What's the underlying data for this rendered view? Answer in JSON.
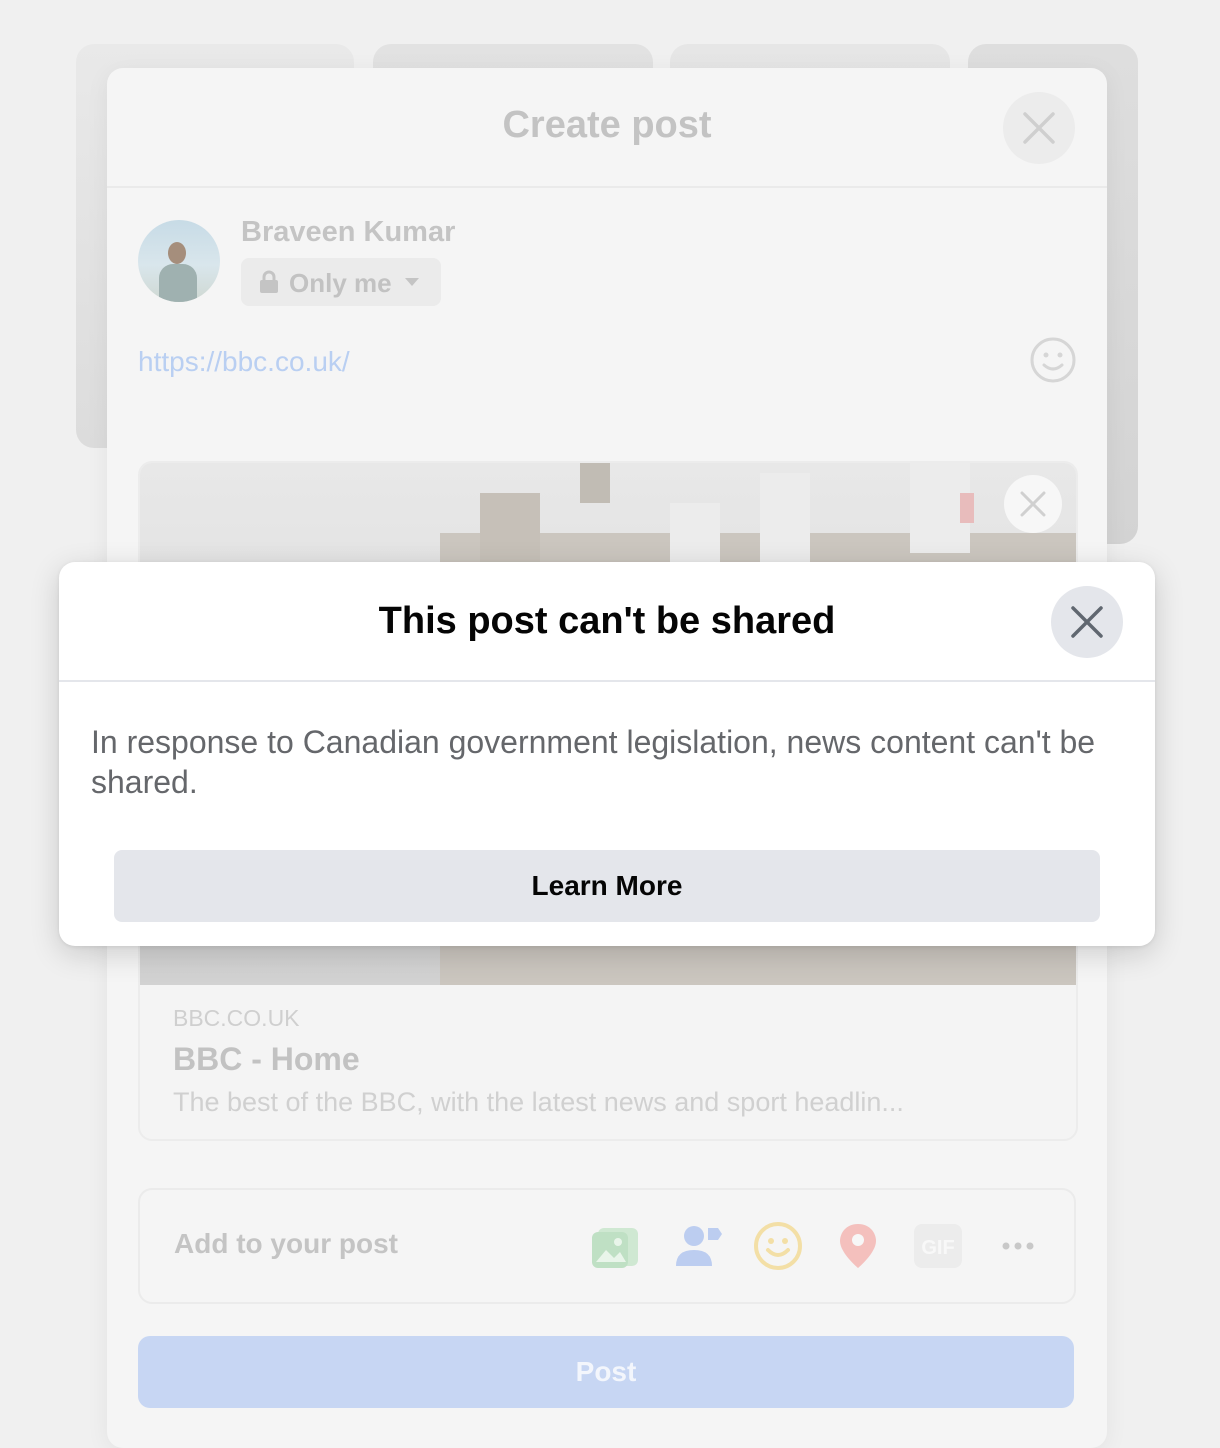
{
  "create_post": {
    "title": "Create post",
    "user_name": "Braveen Kumar",
    "privacy_label": "Only me",
    "post_text": "https://bbc.co.uk/",
    "link_preview": {
      "domain": "BBC.CO.UK",
      "title": "BBC - Home",
      "description": "The best of the BBC, with the latest news and sport headlin..."
    },
    "add_to_post_label": "Add to your post",
    "add_icons": [
      "photo-video-icon",
      "tag-people-icon",
      "feeling-icon",
      "check-in-icon",
      "gif-icon",
      "more-icon"
    ],
    "post_button_label": "Post"
  },
  "modal": {
    "title": "This post can't be shared",
    "message": "In response to Canadian government legislation, news content can't be shared.",
    "learn_more_label": "Learn More"
  },
  "colors": {
    "modal_text": "#050505",
    "secondary_text": "#65676b",
    "button_grey": "#e4e6eb",
    "post_button_disabled": "#c7d6f3"
  }
}
